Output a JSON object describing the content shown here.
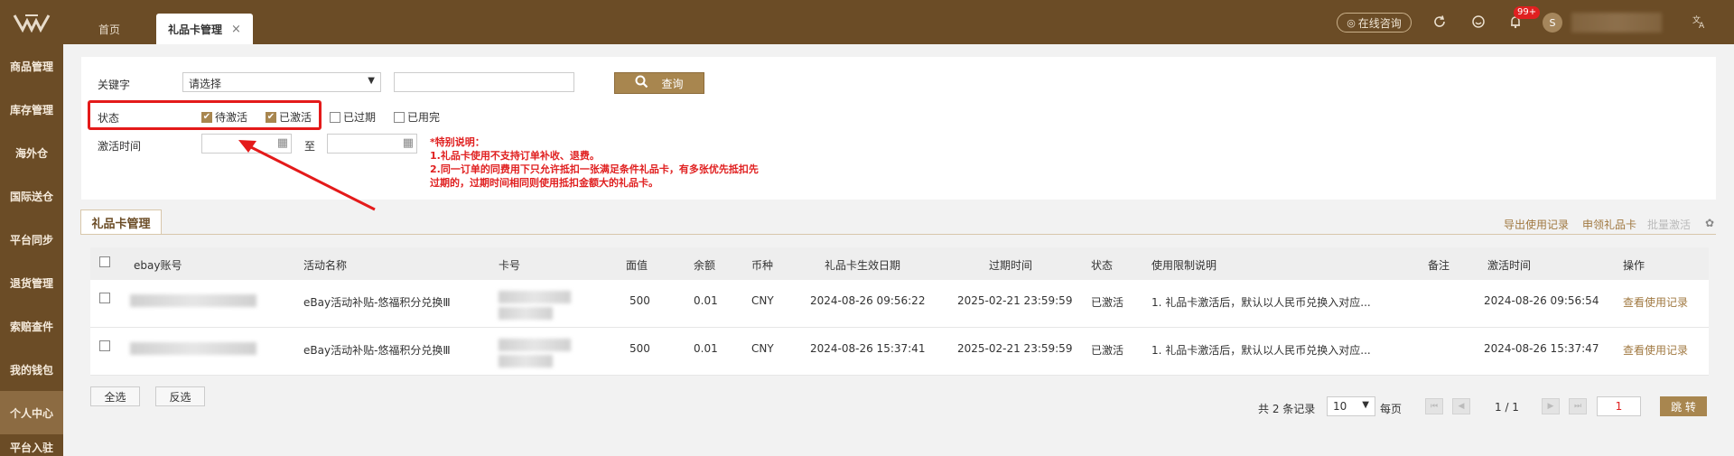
{
  "header": {
    "tabs": [
      {
        "label": "首页"
      },
      {
        "label": "礼品卡管理",
        "close": "×"
      }
    ],
    "consult": "在线咨询",
    "badge": "99+",
    "avatar": "S",
    "icons": [
      "refresh-icon",
      "smile-icon",
      "bell-icon",
      "translate-icon"
    ]
  },
  "sidebar": {
    "items": [
      {
        "label": "商品管理"
      },
      {
        "label": "库存管理"
      },
      {
        "label": "海外仓"
      },
      {
        "label": "国际送仓"
      },
      {
        "label": "平台同步"
      },
      {
        "label": "退货管理"
      },
      {
        "label": "索赔查件"
      },
      {
        "label": "我的钱包"
      },
      {
        "label": "个人中心"
      },
      {
        "label": "平台入驻"
      }
    ]
  },
  "filter": {
    "keyword_label": "关键字",
    "keyword_select": "请选择",
    "keyword_value": "",
    "query_label": "查询",
    "status_label": "状态",
    "statuses": [
      {
        "label": "待激活",
        "checked": true
      },
      {
        "label": "已激活",
        "checked": true
      },
      {
        "label": "已过期",
        "checked": false
      },
      {
        "label": "已用完",
        "checked": false
      }
    ],
    "activate_time_label": "激活时间",
    "to_label": "至",
    "note_title": "*特别说明：",
    "note_lines": [
      "1.礼品卡使用不支持订单补收、退费。",
      "2.同一订单的同费用下只允许抵扣一张满足条件礼品卡，有多张优先抵扣先",
      "过期的，过期时间相同则使用抵扣金额大的礼品卡。"
    ]
  },
  "panel": {
    "title": "礼品卡管理",
    "actions": [
      "导出使用记录",
      "申领礼品卡",
      "批量激活"
    ]
  },
  "table": {
    "headers": [
      "ebay账号",
      "活动名称",
      "卡号",
      "面值",
      "余额",
      "币种",
      "礼品卡生效日期",
      "过期时间",
      "状态",
      "使用限制说明",
      "备注",
      "激活时间",
      "操作"
    ],
    "rows": [
      {
        "activity": "eBay活动补贴-悠福积分兑换Ⅲ",
        "face": "500",
        "balance": "0.01",
        "currency": "CNY",
        "effective": "2024-08-26 09:56:22",
        "expire": "2025-02-21 23:59:59",
        "status": "已激活",
        "limit": "1. 礼品卡激活后，默认以人民币兑换入对应...",
        "remark": "",
        "activated": "2024-08-26 09:56:54",
        "op": "查看使用记录"
      },
      {
        "activity": "eBay活动补贴-悠福积分兑换Ⅲ",
        "face": "500",
        "balance": "0.01",
        "currency": "CNY",
        "effective": "2024-08-26 15:37:41",
        "expire": "2025-02-21 23:59:59",
        "status": "已激活",
        "limit": "1. 礼品卡激活后，默认以人民币兑换入对应...",
        "remark": "",
        "activated": "2024-08-26 15:37:47",
        "op": "查看使用记录"
      }
    ]
  },
  "footer": {
    "select_all": "全选",
    "invert": "反选",
    "total": "共 2 条记录",
    "page_size": "10",
    "per_page": "每页",
    "page_info": "1 / 1",
    "page_input": "1",
    "jump": "跳 转"
  },
  "colors": {
    "brand": "#6b4c26",
    "accent": "#a8864f",
    "alert": "#e41a1a"
  }
}
